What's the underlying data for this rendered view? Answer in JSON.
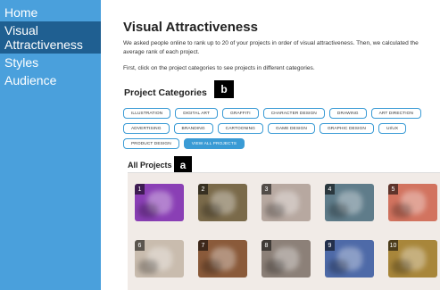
{
  "sidebar": {
    "items": [
      {
        "label": "Home"
      },
      {
        "label": "Visual Attractiveness"
      },
      {
        "label": "Styles"
      },
      {
        "label": "Audience"
      }
    ]
  },
  "main": {
    "title": "Visual Attractiveness",
    "intro": "We asked people online to rank up to 20 of your projects in order of visual attractiveness. Then, we calculated the average rank of each project.",
    "note": "First, click on the project categories to see projects in different categories.",
    "categories_heading": "Project Categories",
    "categories": [
      "ILLUSTRATION",
      "DIGITAL ART",
      "GRAFFITI",
      "CHARACTER DESIGN",
      "DRAWING",
      "ART DIRECTION",
      "ADVERTISING",
      "BRANDING",
      "CARTOONING",
      "GAME DESIGN",
      "GRAPHIC DESIGN",
      "UI/UX",
      "PRODUCT DESIGN"
    ],
    "view_all": "VIEW ALL PROJECTS",
    "all_projects_label": "All Projects"
  },
  "annotations": {
    "a": "a",
    "b": "b"
  },
  "projects": [
    {
      "rank": "1",
      "color": "#8a3fb5"
    },
    {
      "rank": "2",
      "color": "#7a6a4a"
    },
    {
      "rank": "3",
      "color": "#b7a8a0"
    },
    {
      "rank": "4",
      "color": "#5f7c8a"
    },
    {
      "rank": "5",
      "color": "#d2735f"
    },
    {
      "rank": "6",
      "color": "#c9bcae"
    },
    {
      "rank": "7",
      "color": "#8a5a3a"
    },
    {
      "rank": "8",
      "color": "#8c8078"
    },
    {
      "rank": "9",
      "color": "#4e6aa8"
    },
    {
      "rank": "10",
      "color": "#a8863a"
    }
  ]
}
